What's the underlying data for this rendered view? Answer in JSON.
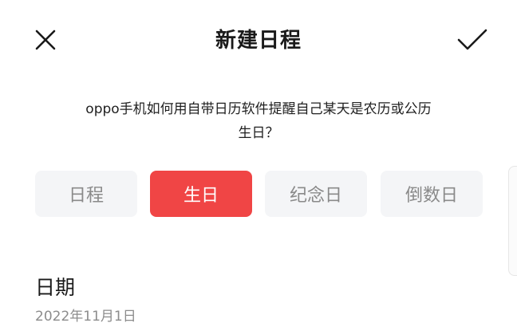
{
  "header": {
    "title": "新建日程",
    "close_icon": "close-icon",
    "confirm_icon": "checkmark-icon"
  },
  "question": {
    "line1": "oppo手机如何用自带日历软件提醒自己某天是农历或公历",
    "line2": "生日？"
  },
  "tabs": [
    {
      "label": "日程",
      "active": false
    },
    {
      "label": "生日",
      "active": true
    },
    {
      "label": "纪念日",
      "active": false
    },
    {
      "label": "倒数日",
      "active": false
    }
  ],
  "colors": {
    "accent": "#f04545",
    "tab_background": "#f4f5f7",
    "tab_text": "#8a8a8a"
  },
  "date_section": {
    "label": "日期",
    "value": "2022年11月1日"
  }
}
